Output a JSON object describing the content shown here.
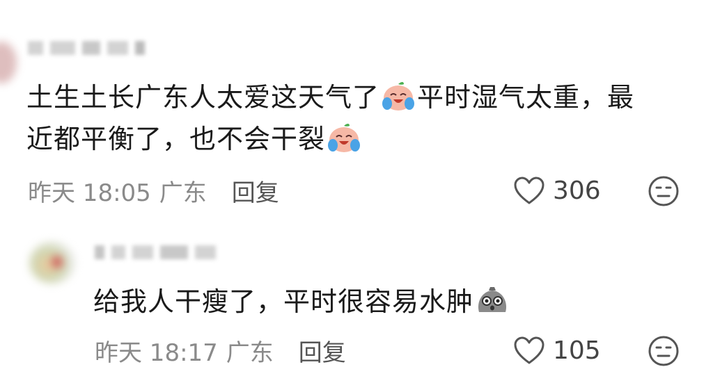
{
  "comments": [
    {
      "text_part1": "土生土长广东人太爱这天气了",
      "text_part2": "平时湿气太重，最",
      "text_line2": "近都平衡了，也不会干裂",
      "emoji_icon": "crying-laughing-peach-emoji",
      "time": "昨天 18:05",
      "location": "广东",
      "reply_label": "回复",
      "likes": "306"
    },
    {
      "text": "给我人干瘦了，平时很容易水肿",
      "emoji_icon": "shocked-gray-blob-emoji",
      "time": "昨天 18:17",
      "location": "广东",
      "reply_label": "回复",
      "likes": "105"
    }
  ],
  "colors": {
    "text": "#1a1a1a",
    "meta": "#8a8a8a",
    "reply": "#555555",
    "icon": "#555555"
  }
}
